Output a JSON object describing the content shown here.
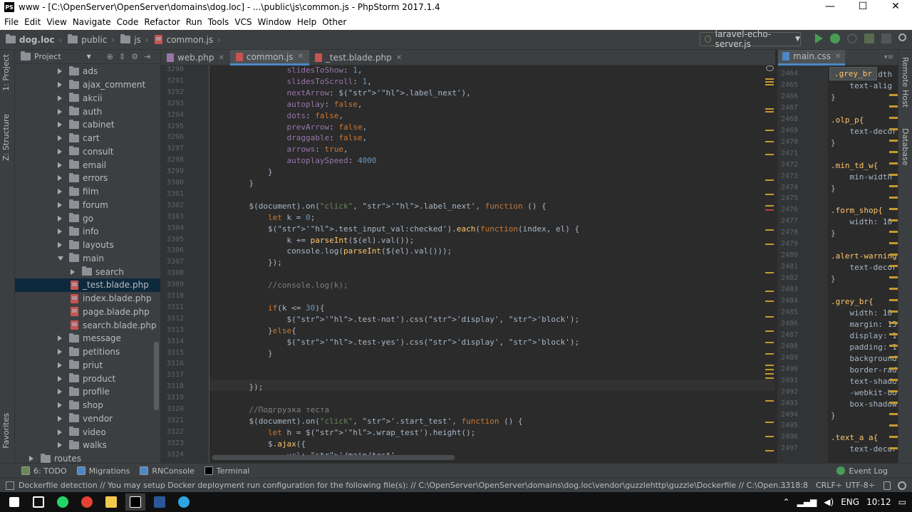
{
  "window": {
    "title": "www - [C:\\OpenServer\\OpenServer\\domains\\dog.loc] - ...\\public\\js\\common.js - PhpStorm 2017.1.4",
    "app_icon": "PS",
    "minimize": "—",
    "maximize": "☐",
    "close": "✕"
  },
  "menu": [
    "File",
    "Edit",
    "View",
    "Navigate",
    "Code",
    "Refactor",
    "Run",
    "Tools",
    "VCS",
    "Window",
    "Help",
    "Other"
  ],
  "breadcrumbs": [
    "dog.loc",
    "public",
    "js",
    "common.js"
  ],
  "run_config": {
    "label": "laravel-echo-server.js",
    "arrow": "▼"
  },
  "left_tabs": {
    "project": "1: Project",
    "structure": "Z: Structure",
    "favorites": "Favorites"
  },
  "right_tabs": {
    "remote": "Remote Host",
    "database": "Database"
  },
  "project_panel": {
    "title": "Project",
    "dropdown": "▼",
    "tree": [
      {
        "label": "ads",
        "type": "folder",
        "level": 1,
        "open": false
      },
      {
        "label": "ajax_comment",
        "type": "folder",
        "level": 1,
        "open": false
      },
      {
        "label": "akcii",
        "type": "folder",
        "level": 1,
        "open": false
      },
      {
        "label": "auth",
        "type": "folder",
        "level": 1,
        "open": false
      },
      {
        "label": "cabinet",
        "type": "folder",
        "level": 1,
        "open": false
      },
      {
        "label": "cart",
        "type": "folder",
        "level": 1,
        "open": false
      },
      {
        "label": "consult",
        "type": "folder",
        "level": 1,
        "open": false
      },
      {
        "label": "email",
        "type": "folder",
        "level": 1,
        "open": false
      },
      {
        "label": "errors",
        "type": "folder",
        "level": 1,
        "open": false
      },
      {
        "label": "film",
        "type": "folder",
        "level": 1,
        "open": false
      },
      {
        "label": "forum",
        "type": "folder",
        "level": 1,
        "open": false
      },
      {
        "label": "go",
        "type": "folder",
        "level": 1,
        "open": false
      },
      {
        "label": "info",
        "type": "folder",
        "level": 1,
        "open": false
      },
      {
        "label": "layouts",
        "type": "folder",
        "level": 1,
        "open": false
      },
      {
        "label": "main",
        "type": "folder",
        "level": 1,
        "open": true
      },
      {
        "label": "search",
        "type": "folder",
        "level": 2,
        "open": false
      },
      {
        "label": "_test.blade.php",
        "type": "file",
        "level": 2,
        "selected": true
      },
      {
        "label": "index.blade.php",
        "type": "file",
        "level": 2
      },
      {
        "label": "page.blade.php",
        "type": "file",
        "level": 2
      },
      {
        "label": "search.blade.php",
        "type": "file",
        "level": 2
      },
      {
        "label": "message",
        "type": "folder",
        "level": 1,
        "open": false
      },
      {
        "label": "petitions",
        "type": "folder",
        "level": 1,
        "open": false
      },
      {
        "label": "priut",
        "type": "folder",
        "level": 1,
        "open": false
      },
      {
        "label": "product",
        "type": "folder",
        "level": 1,
        "open": false
      },
      {
        "label": "profile",
        "type": "folder",
        "level": 1,
        "open": false
      },
      {
        "label": "shop",
        "type": "folder",
        "level": 1,
        "open": false
      },
      {
        "label": "vendor",
        "type": "folder",
        "level": 1,
        "open": false
      },
      {
        "label": "video",
        "type": "folder",
        "level": 1,
        "open": false
      },
      {
        "label": "walks",
        "type": "folder",
        "level": 1,
        "open": false
      },
      {
        "label": "routes",
        "type": "folder",
        "level": 0,
        "open": false
      }
    ]
  },
  "editor_tabs": [
    {
      "label": "web.php",
      "icon_color": "#9876aa",
      "active": false
    },
    {
      "label": "common.js",
      "icon_color": "#c75450",
      "active": true
    },
    {
      "label": "_test.blade.php",
      "icon_color": "#c75450",
      "active": false
    }
  ],
  "editor": {
    "line_numbers": [
      "3290",
      "3291",
      "3292",
      "3293",
      "3294",
      "3295",
      "3296",
      "3297",
      "3298",
      "3299",
      "3300",
      "3301",
      "3302",
      "3303",
      "3304",
      "3305",
      "3306",
      "3307",
      "3308",
      "3309",
      "3310",
      "3311",
      "3312",
      "3313",
      "3314",
      "3315",
      "3316",
      "3317",
      "3318",
      "3319",
      "3320",
      "3321",
      "3322",
      "3323",
      "3324"
    ],
    "lines": [
      "            slidesToShow: 1,",
      "            slidesToScroll: 1,",
      "            nextArrow: $('.label_next'),",
      "            autoplay: false,",
      "            dots: false,",
      "            prevArrow: false,",
      "            draggable: false,",
      "            arrows: true,",
      "            autoplaySpeed: 4000",
      "        }",
      "    }",
      "",
      "    $(document).on(\"click\", '.label_next', function () {",
      "        let k = 0;",
      "        $('.test_input_val:checked').each(function(index, el) {",
      "            k += parseInt($(el).val());",
      "            console.log(parseInt($(el).val()));",
      "        });",
      "",
      "        //console.log(k);",
      "",
      "        if(k <= 30){",
      "            $('.test-not').css('display', 'block');",
      "        }else{",
      "            $('.test-yes').css('display', 'block');",
      "        }",
      "",
      "",
      "    });",
      "",
      "    //Подгрузка теста",
      "    $(document).on(\"click\", '.start_test', function () {",
      "        let h = $('.wrap_test').height();",
      "        $.ajax({",
      "            url: '/main/test',"
    ]
  },
  "right_editor": {
    "tab": "main.css",
    "tooltip": ".grey_br",
    "line_numbers": [
      "2464",
      "2465",
      "2466",
      "2467",
      "2468",
      "2469",
      "2470",
      "2471",
      "2472",
      "2473",
      "2474",
      "2475",
      "2476",
      "2477",
      "2478",
      "2479",
      "2480",
      "2481",
      "2482",
      "2483",
      "2484",
      "2485",
      "2486",
      "2487",
      "2488",
      "2489",
      "2490",
      "2491",
      "2492",
      "2493",
      "2494",
      "2495",
      "2496",
      "2497"
    ],
    "lines": [
      "    min-width",
      "    text-alig",
      "}",
      "",
      ".olp_p{",
      "    text-decor",
      "}",
      "",
      ".min_td_w{",
      "    min-width",
      "}",
      "",
      ".form_shop{",
      "    width: 10",
      "}",
      "",
      ".alert-warning",
      "    text-decor",
      "}",
      "",
      ".grey_br{",
      "    width: 10",
      "    margin: 15",
      "    display: 1",
      "    padding: 1",
      "    background",
      "    border-rad",
      "    text-shado",
      "    -webkit-bo",
      "    box-shadow",
      "}",
      "",
      ".text_a a{",
      "    text-decor"
    ]
  },
  "bottom_tools": [
    {
      "label": "6: TODO",
      "icon": "todo-icon",
      "color": "#6a8759"
    },
    {
      "label": "Migrations",
      "icon": "migrations-icon",
      "color": "#4a88c7"
    },
    {
      "label": "RNConsole",
      "icon": "rnconsole-icon",
      "color": "#4a88c7"
    },
    {
      "label": "Terminal",
      "icon": "terminal-icon",
      "color": "#000000"
    }
  ],
  "event_log": "Event Log",
  "status": {
    "message": "Dockerfile detection  // You may setup Docker deployment run configuration for the following file(s): // C:\\OpenServer\\OpenServer\\domains\\dog.loc\\vendor\\guzzlehttp\\guzzle\\Dockerfile // C:\\OpenServer\\OpenSe...",
    "position": "3318:8",
    "line_sep": "CRLF÷",
    "encoding": "UTF-8÷"
  },
  "taskbar": {
    "lang": "ENG",
    "time": "10:12",
    "apps": [
      {
        "name": "windows-start-icon",
        "color": "#ffffff"
      },
      {
        "name": "task-view-icon",
        "color": "#ffffff"
      },
      {
        "name": "whatsapp-icon",
        "color": "#25d366"
      },
      {
        "name": "chrome-icon",
        "color": "#e34133"
      },
      {
        "name": "explorer-icon",
        "color": "#f2c94c"
      },
      {
        "name": "phpstorm-icon",
        "color": "#ffffff"
      },
      {
        "name": "word-icon",
        "color": "#2b579a"
      },
      {
        "name": "telegram-icon",
        "color": "#2ca5e0"
      }
    ]
  }
}
